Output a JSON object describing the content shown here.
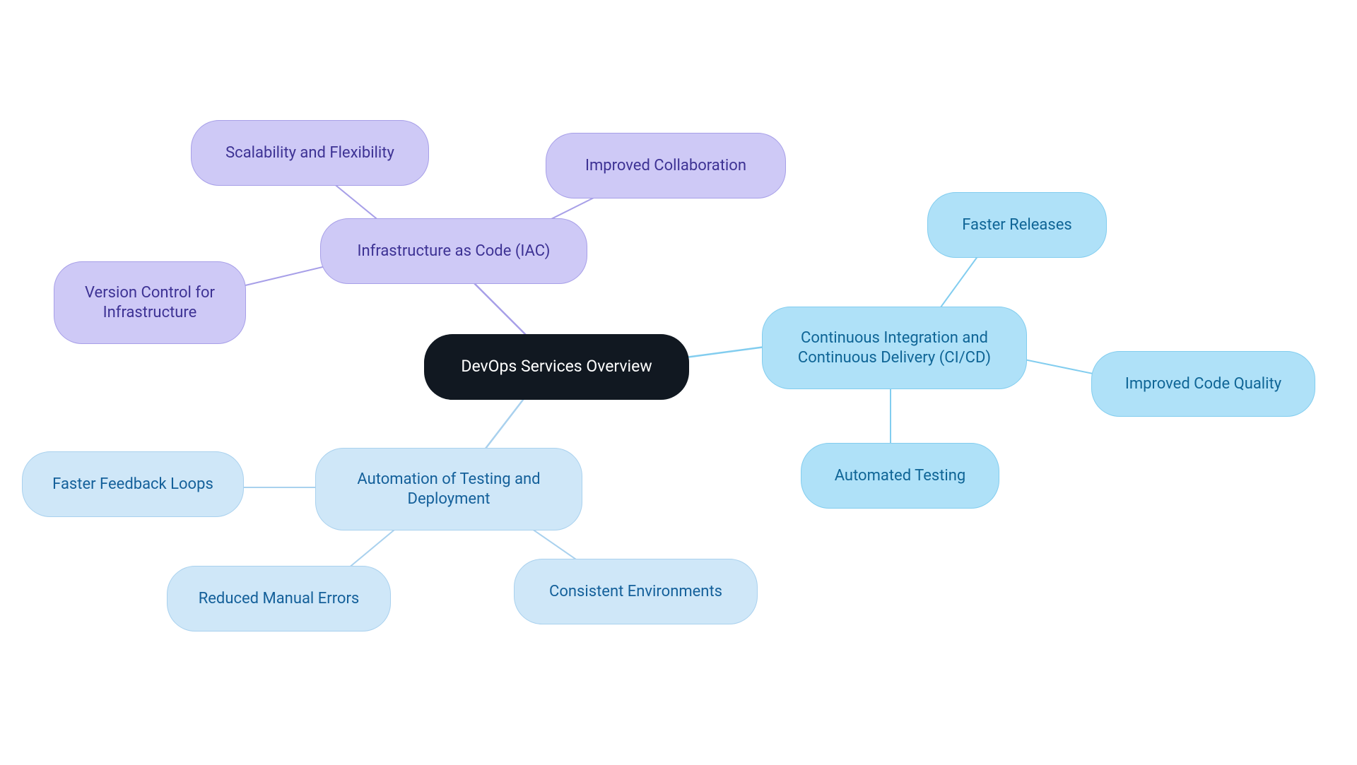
{
  "center": {
    "label": "DevOps Services Overview"
  },
  "branches": {
    "iac": {
      "label": "Infrastructure as Code (IAC)",
      "children": {
        "scalability": "Scalability and Flexibility",
        "collaboration": "Improved Collaboration",
        "version_control": "Version Control for Infrastructure"
      }
    },
    "cicd": {
      "label": "Continuous Integration and Continuous Delivery (CI/CD)",
      "children": {
        "faster_releases": "Faster Releases",
        "code_quality": "Improved Code Quality",
        "automated_testing": "Automated Testing"
      }
    },
    "automation": {
      "label": "Automation of Testing and Deployment",
      "children": {
        "feedback_loops": "Faster Feedback Loops",
        "manual_errors": "Reduced Manual Errors",
        "consistent_env": "Consistent Environments"
      }
    }
  },
  "colors": {
    "center_bg": "#111821",
    "purple_bg": "#cec9f6",
    "purple_border": "#a79fe8",
    "purple_text": "#3d3294",
    "blue_light_bg": "#cfe7f8",
    "blue_light_border": "#a9d1ee",
    "blue_med_bg": "#afe1f8",
    "blue_med_border": "#82cdef",
    "blue_text": "#14609a"
  }
}
